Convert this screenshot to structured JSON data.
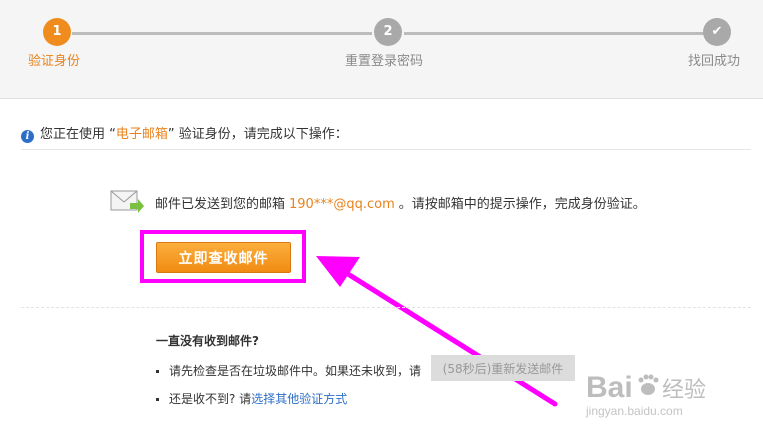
{
  "steps": [
    {
      "number": "1",
      "label": "验证身份",
      "state": "active"
    },
    {
      "number": "2",
      "label": "重置登录密码",
      "state": "pending"
    },
    {
      "number": "✔",
      "label": "找回成功",
      "state": "pending"
    }
  ],
  "intro": {
    "prefix": "您正在使用 “",
    "method": "电子邮箱",
    "suffix": "” 验证身份，请完成以下操作："
  },
  "mail": {
    "prefix": "邮件已发送到您的邮箱",
    "address": "190***@qq.com",
    "suffix": "。请按邮箱中的提示操作，完成身份验证。"
  },
  "buttons": {
    "check_mail": "立即查收邮件",
    "resend": "(58秒后)重新发送邮件"
  },
  "faq": {
    "title": "一直没有收到邮件?",
    "item1": "请先检查是否在垃圾邮件中。如果还未收到，请",
    "item2_prefix": "还是收不到? 请",
    "item2_link": "选择其他验证方式"
  },
  "watermark": {
    "brand": "Bai",
    "brand_cn": "经验",
    "url": "jingyan.baidu.com"
  },
  "colors": {
    "accent": "#f08c1e",
    "highlight": "#ff00ff",
    "link": "#2d6fc7",
    "inactive": "#a9a9a9"
  }
}
